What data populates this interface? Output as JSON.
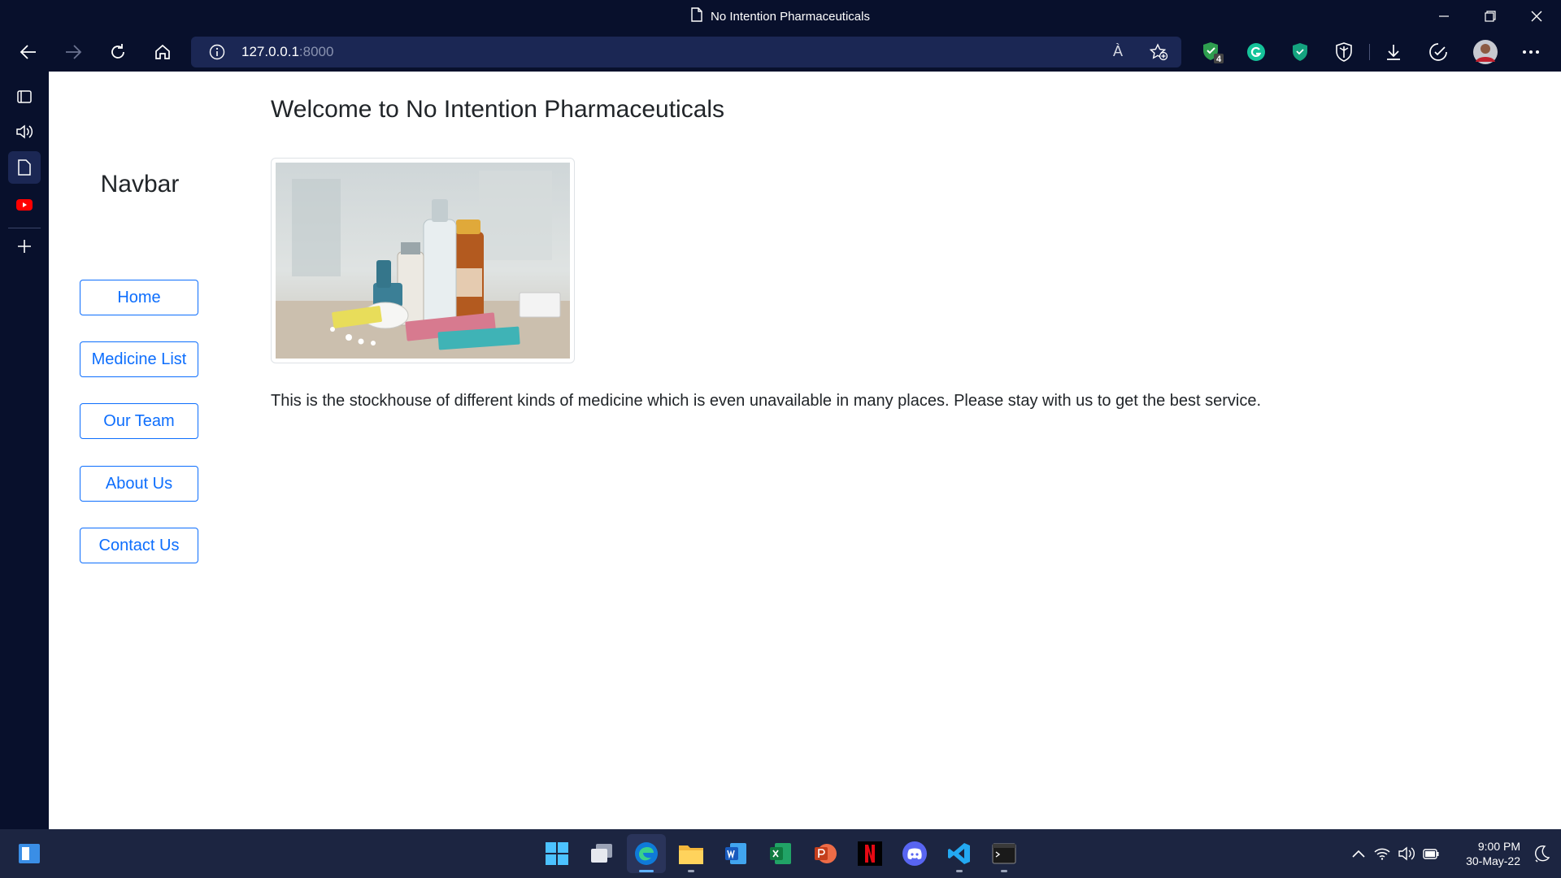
{
  "window": {
    "title": "No Intention Pharmaceuticals"
  },
  "address_bar": {
    "host": "127.0.0.1",
    "port": ":8000",
    "read_aloud_label": "À"
  },
  "extensions": {
    "badge_count": "4"
  },
  "page": {
    "heading": "Welcome to No Intention Pharmaceuticals",
    "nav_title": "Navbar",
    "nav_items": [
      {
        "label": "Home"
      },
      {
        "label": "Medicine List"
      },
      {
        "label": "Our Team"
      },
      {
        "label": "About Us"
      },
      {
        "label": "Contact Us"
      }
    ],
    "paragraph": "This is the stockhouse of different kinds of medicine which is even unavailable in many places. Please stay with us to get the best service."
  },
  "taskbar": {
    "apps": [
      "start",
      "task-view",
      "edge",
      "file-explorer",
      "word",
      "excel",
      "powerpoint",
      "netflix",
      "discord",
      "vscode",
      "terminal"
    ],
    "time": "9:00 PM",
    "date": "30-May-22"
  },
  "colors": {
    "chrome_bg": "#08102c",
    "link_blue": "#0d6efd",
    "taskbar_bg": "#1c2541"
  }
}
